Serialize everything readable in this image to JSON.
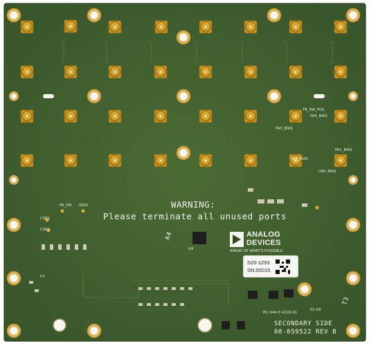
{
  "board": {
    "warning_title": "WARNING:",
    "warning_body": "Please terminate all unused ports",
    "labels": {
      "pa_on": "PA_ON",
      "sdio": "SDIO",
      "csb1": "CSB1",
      "csb2": "CSB2",
      "tr_sw_pos": "TR_SW_POS",
      "pa4_bias": "PA4_BIAS",
      "pa3_bias": "PA3_BIAS",
      "pa1_bias": "PA1_BIAS",
      "pa2_bias": "PA2_BIAS",
      "lna_bias": "LNA_BIAS",
      "p2": "P2",
      "u4": "U4",
      "a4": "A4",
      "t3": "T3",
      "rev_0103": "01-03",
      "pcb_code": "M1 94V-0 4220-01"
    },
    "logo": {
      "line1": "ANALOG",
      "line2": "DEVICES",
      "tagline": "AHEAD OF WHAT'S POSSIBLE"
    },
    "sticker": {
      "part": "S20-1293",
      "serial": "SN:00015"
    },
    "footer": {
      "side": "SECONDARY SIDE",
      "part_rev": "08-059522 REV B"
    }
  }
}
